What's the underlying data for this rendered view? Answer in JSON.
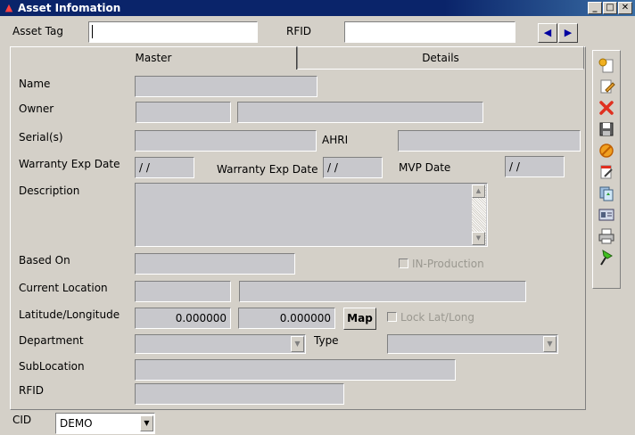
{
  "window": {
    "title": "Asset Infomation",
    "minimize": "_",
    "maximize": "□",
    "close": "✕"
  },
  "top": {
    "asset_tag_label": "Asset Tag",
    "asset_tag_value": "",
    "rfid_label": "RFID",
    "rfid_value": "",
    "prev_glyph": "◀",
    "next_glyph": "▶"
  },
  "tabs": [
    {
      "label": "Master",
      "active": true
    },
    {
      "label": "Details",
      "active": false
    }
  ],
  "form": {
    "name_label": "Name",
    "owner_label": "Owner",
    "serials_label": "Serial(s)",
    "ahri_label": "AHRI",
    "warranty_label_1": "Warranty Exp Date",
    "warranty_value_1": "/ /",
    "warranty_label_2": "Warranty Exp Date",
    "warranty_value_2": "/ /",
    "mvp_label": "MVP Date",
    "mvp_value": "/ /",
    "description_label": "Description",
    "based_on_label": "Based On",
    "in_production_label": "IN-Production",
    "current_location_label": "Current Location",
    "latlong_label": "Latitude/Longitude",
    "latitude": "0.000000",
    "longitude": "0.000000",
    "map_button": "Map",
    "lock_label": "Lock Lat/Long",
    "department_label": "Department",
    "type_label": "Type",
    "sublocation_label": "SubLocation",
    "rfid_label": "RFID"
  },
  "footer": {
    "cid_label": "CID",
    "cid_value": "DEMO"
  },
  "toolbar": {
    "icons": [
      "new-record-icon",
      "edit-icon",
      "delete-icon",
      "save-icon",
      "cancel-icon",
      "notes-icon",
      "copy-icon",
      "card-icon",
      "print-icon",
      "pin-icon"
    ]
  },
  "colors": {
    "title_bar": "#0a246a",
    "window_bg": "#d4d0c8",
    "field_bg": "#c8c8cc",
    "delete_red": "#e03020"
  }
}
